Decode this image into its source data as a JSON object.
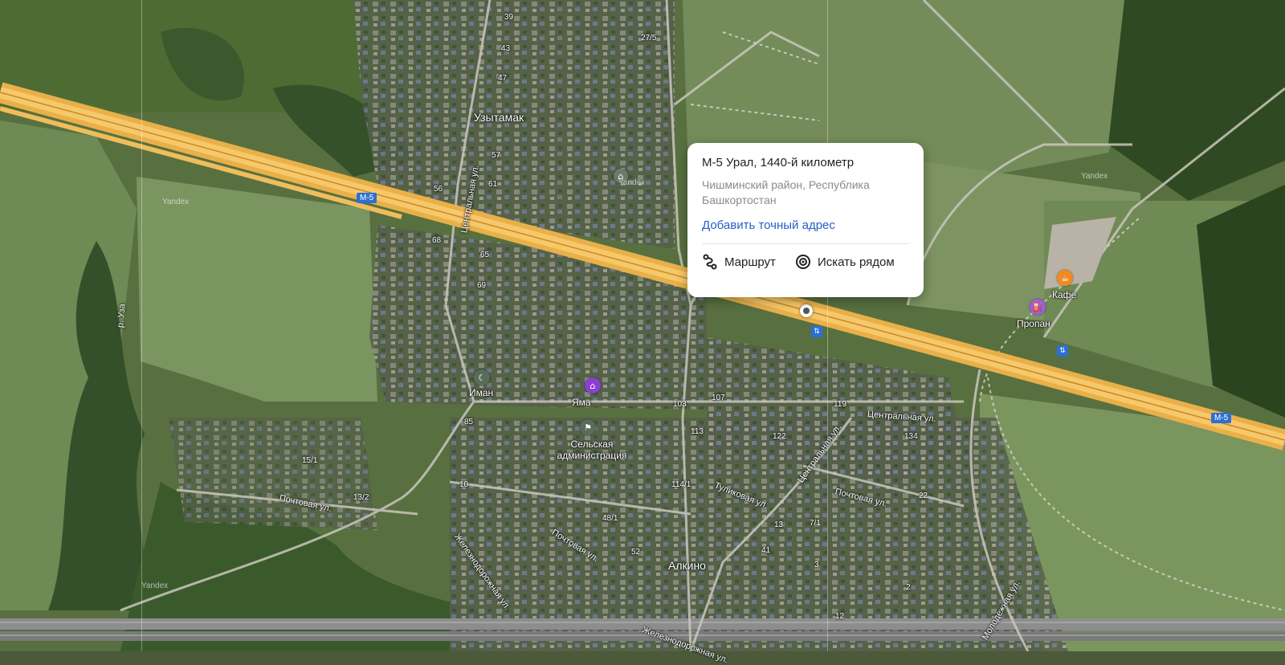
{
  "card": {
    "title": "М-5 Урал, 1440-й километр",
    "subtitle": "Чишминский район, Республика Башкортостан",
    "add_address_label": "Добавить точный адрес",
    "route_label": "Маршрут",
    "search_nearby_label": "Искать рядом"
  },
  "map": {
    "places": {
      "uzytamak": "Узытамак",
      "alkino": "Алкино"
    },
    "pois": {
      "iman": "Иман",
      "yama": "Яма",
      "admin": "Сельская администрация",
      "cafe": "Кафе",
      "propane": "Пропан"
    },
    "streets": {
      "centralnaya_1": "Центральная ул.",
      "centralnaya_2": "Центральная ул.",
      "centralnaya_3": "Центральная ул.",
      "pochtovaya_1": "Почтовая ул.",
      "pochtovaya_2": "Почтовая ул.",
      "pochtovaya_3": "Почтовая ул.",
      "tulikovaya": "Туликовая ул.",
      "zheleznodorozhnaya_1": "Железнодорожная ул.",
      "zheleznodorozhnaya_2": "Железнодорожная ул.",
      "molodezhnaya": "Молодежная ул.",
      "river": "р. Уза"
    },
    "road_shields": {
      "m5_left": "М-5",
      "m5_right": "М-5"
    },
    "watermarks": {
      "yandex_1": "Yandex",
      "yandex_2": "Yandex",
      "yandex_3": "Yandex",
      "yandex_4": "Yandex"
    },
    "house_numbers": {
      "n39": "39",
      "n43": "43",
      "n47": "47",
      "n57": "57",
      "n61": "61",
      "n56": "56",
      "n68": "68",
      "n65": "65",
      "n69": "69",
      "n85": "85",
      "n103": "103",
      "n107": "107",
      "n119": "119",
      "n113": "113",
      "n122": "122",
      "n134": "134",
      "n151": "15/1",
      "n132": "13/2",
      "n10": "10",
      "n481": "48/1",
      "n1141": "114/1",
      "n52": "52",
      "n41": "41",
      "n71": "7/1",
      "n13": "13",
      "n3": "3",
      "n2": "2",
      "n12": "12",
      "n22": "22",
      "n275": "27/5"
    }
  },
  "colors": {
    "highway": "#f3b54a",
    "link": "#2461c6",
    "badge_blue": "#2c6fd6",
    "yama_pin": "#8a3fd1",
    "cafe_pin": "#f08a24",
    "propane_pin": "#9b5fe0"
  }
}
